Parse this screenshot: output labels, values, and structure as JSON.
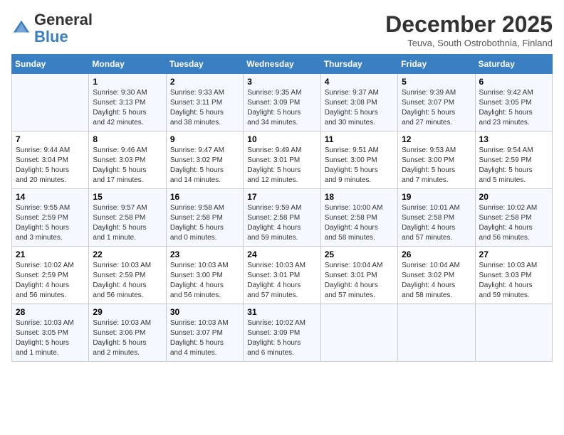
{
  "header": {
    "logo_general": "General",
    "logo_blue": "Blue",
    "month": "December 2025",
    "location": "Teuva, South Ostrobothnia, Finland"
  },
  "days_of_week": [
    "Sunday",
    "Monday",
    "Tuesday",
    "Wednesday",
    "Thursday",
    "Friday",
    "Saturday"
  ],
  "weeks": [
    [
      {
        "day": "",
        "info": ""
      },
      {
        "day": "1",
        "info": "Sunrise: 9:30 AM\nSunset: 3:13 PM\nDaylight: 5 hours\nand 42 minutes."
      },
      {
        "day": "2",
        "info": "Sunrise: 9:33 AM\nSunset: 3:11 PM\nDaylight: 5 hours\nand 38 minutes."
      },
      {
        "day": "3",
        "info": "Sunrise: 9:35 AM\nSunset: 3:09 PM\nDaylight: 5 hours\nand 34 minutes."
      },
      {
        "day": "4",
        "info": "Sunrise: 9:37 AM\nSunset: 3:08 PM\nDaylight: 5 hours\nand 30 minutes."
      },
      {
        "day": "5",
        "info": "Sunrise: 9:39 AM\nSunset: 3:07 PM\nDaylight: 5 hours\nand 27 minutes."
      },
      {
        "day": "6",
        "info": "Sunrise: 9:42 AM\nSunset: 3:05 PM\nDaylight: 5 hours\nand 23 minutes."
      }
    ],
    [
      {
        "day": "7",
        "info": "Sunrise: 9:44 AM\nSunset: 3:04 PM\nDaylight: 5 hours\nand 20 minutes."
      },
      {
        "day": "8",
        "info": "Sunrise: 9:46 AM\nSunset: 3:03 PM\nDaylight: 5 hours\nand 17 minutes."
      },
      {
        "day": "9",
        "info": "Sunrise: 9:47 AM\nSunset: 3:02 PM\nDaylight: 5 hours\nand 14 minutes."
      },
      {
        "day": "10",
        "info": "Sunrise: 9:49 AM\nSunset: 3:01 PM\nDaylight: 5 hours\nand 12 minutes."
      },
      {
        "day": "11",
        "info": "Sunrise: 9:51 AM\nSunset: 3:00 PM\nDaylight: 5 hours\nand 9 minutes."
      },
      {
        "day": "12",
        "info": "Sunrise: 9:53 AM\nSunset: 3:00 PM\nDaylight: 5 hours\nand 7 minutes."
      },
      {
        "day": "13",
        "info": "Sunrise: 9:54 AM\nSunset: 2:59 PM\nDaylight: 5 hours\nand 5 minutes."
      }
    ],
    [
      {
        "day": "14",
        "info": "Sunrise: 9:55 AM\nSunset: 2:59 PM\nDaylight: 5 hours\nand 3 minutes."
      },
      {
        "day": "15",
        "info": "Sunrise: 9:57 AM\nSunset: 2:58 PM\nDaylight: 5 hours\nand 1 minute."
      },
      {
        "day": "16",
        "info": "Sunrise: 9:58 AM\nSunset: 2:58 PM\nDaylight: 5 hours\nand 0 minutes."
      },
      {
        "day": "17",
        "info": "Sunrise: 9:59 AM\nSunset: 2:58 PM\nDaylight: 4 hours\nand 59 minutes."
      },
      {
        "day": "18",
        "info": "Sunrise: 10:00 AM\nSunset: 2:58 PM\nDaylight: 4 hours\nand 58 minutes."
      },
      {
        "day": "19",
        "info": "Sunrise: 10:01 AM\nSunset: 2:58 PM\nDaylight: 4 hours\nand 57 minutes."
      },
      {
        "day": "20",
        "info": "Sunrise: 10:02 AM\nSunset: 2:58 PM\nDaylight: 4 hours\nand 56 minutes."
      }
    ],
    [
      {
        "day": "21",
        "info": "Sunrise: 10:02 AM\nSunset: 2:59 PM\nDaylight: 4 hours\nand 56 minutes."
      },
      {
        "day": "22",
        "info": "Sunrise: 10:03 AM\nSunset: 2:59 PM\nDaylight: 4 hours\nand 56 minutes."
      },
      {
        "day": "23",
        "info": "Sunrise: 10:03 AM\nSunset: 3:00 PM\nDaylight: 4 hours\nand 56 minutes."
      },
      {
        "day": "24",
        "info": "Sunrise: 10:03 AM\nSunset: 3:01 PM\nDaylight: 4 hours\nand 57 minutes."
      },
      {
        "day": "25",
        "info": "Sunrise: 10:04 AM\nSunset: 3:01 PM\nDaylight: 4 hours\nand 57 minutes."
      },
      {
        "day": "26",
        "info": "Sunrise: 10:04 AM\nSunset: 3:02 PM\nDaylight: 4 hours\nand 58 minutes."
      },
      {
        "day": "27",
        "info": "Sunrise: 10:03 AM\nSunset: 3:03 PM\nDaylight: 4 hours\nand 59 minutes."
      }
    ],
    [
      {
        "day": "28",
        "info": "Sunrise: 10:03 AM\nSunset: 3:05 PM\nDaylight: 5 hours\nand 1 minute."
      },
      {
        "day": "29",
        "info": "Sunrise: 10:03 AM\nSunset: 3:06 PM\nDaylight: 5 hours\nand 2 minutes."
      },
      {
        "day": "30",
        "info": "Sunrise: 10:03 AM\nSunset: 3:07 PM\nDaylight: 5 hours\nand 4 minutes."
      },
      {
        "day": "31",
        "info": "Sunrise: 10:02 AM\nSunset: 3:09 PM\nDaylight: 5 hours\nand 6 minutes."
      },
      {
        "day": "",
        "info": ""
      },
      {
        "day": "",
        "info": ""
      },
      {
        "day": "",
        "info": ""
      }
    ]
  ]
}
